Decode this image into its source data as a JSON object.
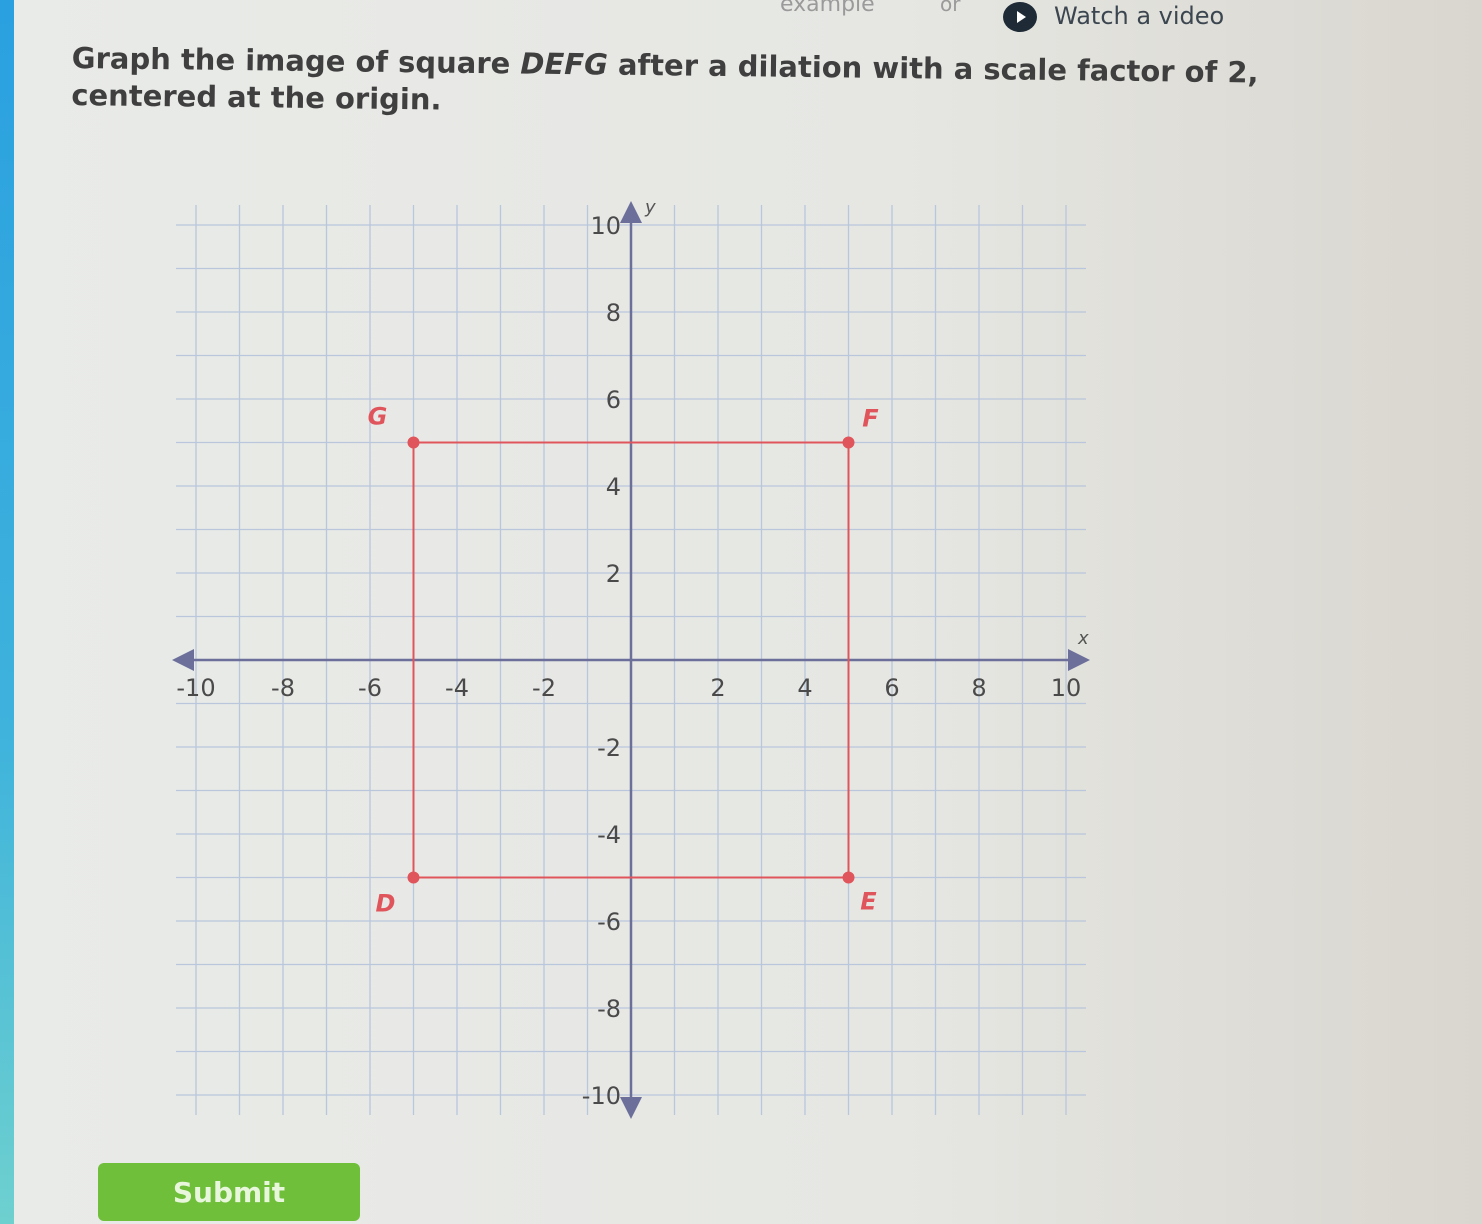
{
  "header": {
    "example_link": "example",
    "or_text": "or",
    "watch_video_label": "Watch a video",
    "watch_icon": "play-circle-icon"
  },
  "question": {
    "part1": "Graph the image of square ",
    "shape_name": "DEFG",
    "part2": " after a dilation with a scale factor of 2, centered at the origin."
  },
  "chart_data": {
    "type": "scatter",
    "xlim": [
      -10,
      10
    ],
    "ylim": [
      -10,
      10
    ],
    "grid": true,
    "x_axis_label": "x",
    "y_axis_label": "y",
    "x_tick_labels": [
      "-10",
      "-8",
      "-6",
      "-4",
      "-2",
      "2",
      "4",
      "6",
      "8",
      "10"
    ],
    "y_tick_labels": [
      "10",
      "8",
      "6",
      "4",
      "2",
      "-2",
      "-4",
      "-6",
      "-8",
      "-10"
    ],
    "points": [
      {
        "label": "D",
        "x": -5,
        "y": -5
      },
      {
        "label": "E",
        "x": 5,
        "y": -5
      },
      {
        "label": "F",
        "x": 5,
        "y": 5
      },
      {
        "label": "G",
        "x": -5,
        "y": 5
      }
    ],
    "polygon_color": "#e0555c",
    "axis_color": "#6b6f9a",
    "grid_color": "#b9c6dc"
  },
  "submit": {
    "label": "Submit",
    "color": "#6fbf3a"
  }
}
